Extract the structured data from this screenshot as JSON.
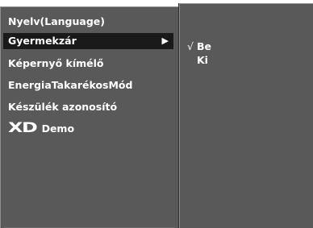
{
  "menu": {
    "items": [
      {
        "label": "Nyelv(Language)"
      },
      {
        "label": "Gyermekzár",
        "arrow": "▶"
      },
      {
        "label": "Képernyő kímélő"
      },
      {
        "label": "EnergiaTakarékosMód"
      },
      {
        "label": "Készülék azonosító"
      },
      {
        "logo": "XD",
        "label": "Demo"
      }
    ],
    "selected_index": 1
  },
  "submenu": {
    "options": [
      {
        "check": "√",
        "label": "Be",
        "checked": true
      },
      {
        "check": "",
        "label": "Ki",
        "checked": false
      }
    ]
  },
  "colors": {
    "panel": "#595959",
    "highlight": "#1a1a1a",
    "text": "#ffffff",
    "background": "#ffffff"
  }
}
